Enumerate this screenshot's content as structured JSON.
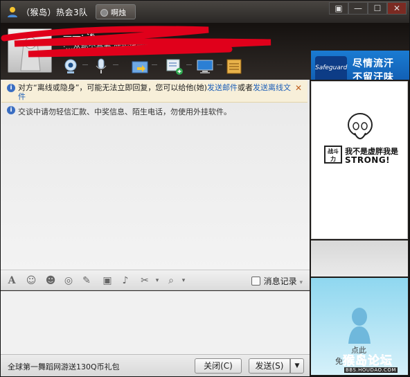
{
  "window": {
    "title": "（猴岛）热会3队",
    "status_button": "啊烛",
    "controls": [
      "▣",
      "—",
      "☐",
      "✕"
    ]
  },
  "buddy": {
    "name": "——· 溪",
    "signature": "·…丛那个翁羞 就能找到嘌唱 …"
  },
  "toolbar_icons": [
    "webcam-icon",
    "microphone-icon",
    "send-file-icon",
    "message-plus-icon",
    "remote-assist-icon",
    "app-box-icon"
  ],
  "ad_banner": {
    "brand": "Safeguard",
    "line1": "尽情流汗",
    "line2": "不留汗味"
  },
  "notices": {
    "offline_prefix": "对方“离线或隐身”，可能无法立即回复，您可以给他(她)",
    "send_mail_link": "发送邮件",
    "or_text": "或者",
    "offline_file_link": "发送离线文件",
    "security_tip": "交谈中请勿轻信汇款、中奖信息、陌生电话，勿使用外挂软件。"
  },
  "format_toolbar": {
    "tools": [
      "A",
      "☺",
      "☻",
      "◎",
      "✎",
      "▣",
      "♪",
      "✂",
      "⌕"
    ],
    "history_label": "消息记录"
  },
  "bottom": {
    "promo_text": "全球第一舞蹈网游送130Q币礼包",
    "close_label": "关闭(C)",
    "send_label": "发送(S)",
    "send_menu_arrow": "▼"
  },
  "sidebar": {
    "meme_box": "战斗力",
    "meme_line1": "我不是虚胖我是",
    "meme_line2": "STRONG!",
    "avatar_hint": "点此",
    "avatar_hint2": "免"
  },
  "watermark": {
    "name": "猴岛论坛",
    "url": "BBS.HOUDAO.COM"
  }
}
